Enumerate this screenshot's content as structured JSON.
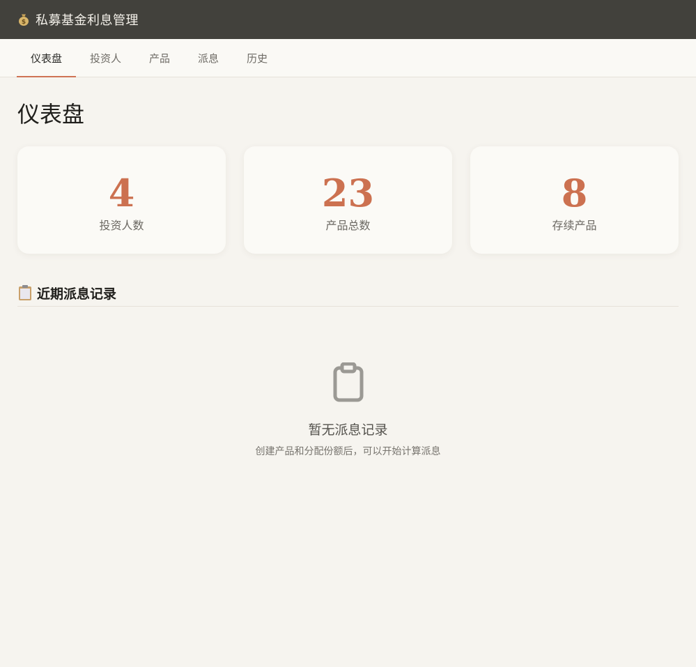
{
  "header": {
    "app_title": "私募基金利息管理",
    "logo_icon": "money-bag-icon"
  },
  "nav": {
    "tabs": [
      {
        "label": "仪表盘",
        "active": true
      },
      {
        "label": "投资人",
        "active": false
      },
      {
        "label": "产品",
        "active": false
      },
      {
        "label": "派息",
        "active": false
      },
      {
        "label": "历史",
        "active": false
      }
    ]
  },
  "dashboard": {
    "title": "仪表盘",
    "stats": [
      {
        "value": "4",
        "label": "投资人数"
      },
      {
        "value": "23",
        "label": "产品总数"
      },
      {
        "value": "8",
        "label": "存续产品"
      }
    ]
  },
  "recent": {
    "icon": "clipboard-icon",
    "title": "近期派息记录",
    "empty": {
      "icon": "clipboard-icon",
      "title": "暂无派息记录",
      "description": "创建产品和分配份额后，可以开始计算派息"
    }
  },
  "colors": {
    "topbar": "#42413c",
    "accent": "#cc7150",
    "background": "#f6f4ef",
    "card": "#fbfaf6"
  }
}
